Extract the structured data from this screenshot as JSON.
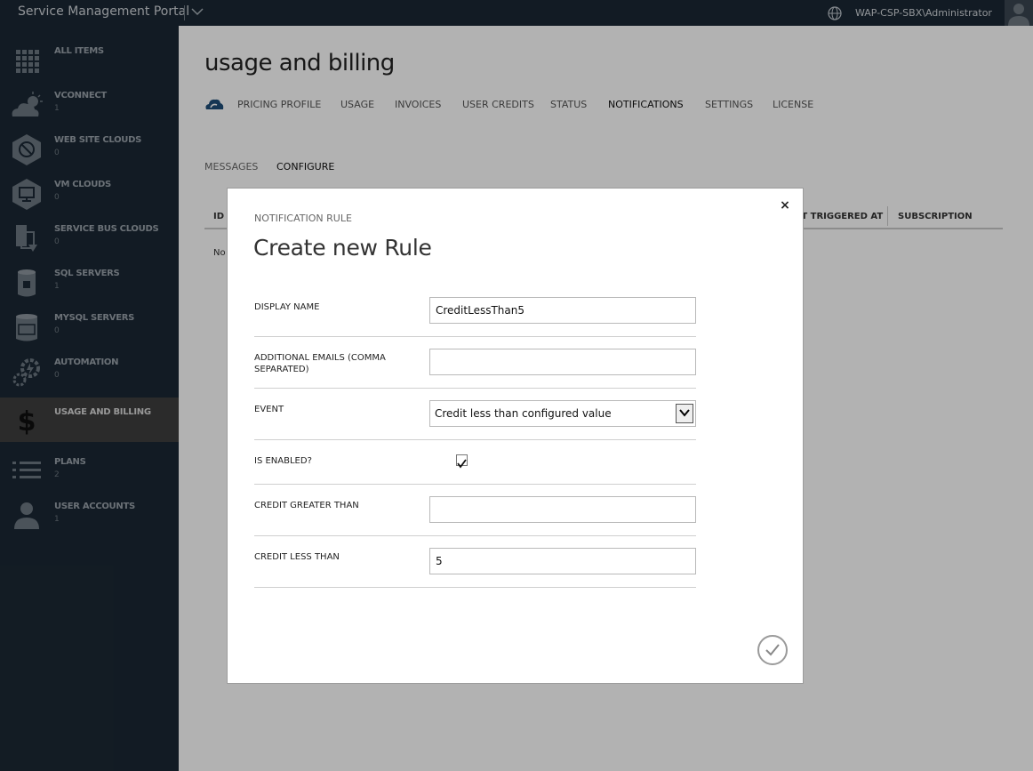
{
  "topbar": {
    "title": "Service Management Portal",
    "user": "WAP-CSP-SBX\\Administrator"
  },
  "sidebar": {
    "items": [
      {
        "label": "ALL ITEMS",
        "count": "",
        "icon": "grid-icon"
      },
      {
        "label": "VCONNECT",
        "count": "1",
        "icon": "cloud-sun-icon"
      },
      {
        "label": "WEB SITE CLOUDS",
        "count": "0",
        "icon": "website-cloud-icon"
      },
      {
        "label": "VM CLOUDS",
        "count": "0",
        "icon": "vm-monitor-icon"
      },
      {
        "label": "SERVICE BUS CLOUDS",
        "count": "0",
        "icon": "service-bus-icon"
      },
      {
        "label": "SQL SERVERS",
        "count": "1",
        "icon": "sql-database-icon"
      },
      {
        "label": "MYSQL SERVERS",
        "count": "0",
        "icon": "mysql-database-icon"
      },
      {
        "label": "AUTOMATION",
        "count": "0",
        "icon": "automation-gears-icon"
      },
      {
        "label": "USAGE AND BILLING",
        "count": "",
        "icon": "dollar-icon"
      },
      {
        "label": "PLANS",
        "count": "2",
        "icon": "plans-list-icon"
      },
      {
        "label": "USER ACCOUNTS",
        "count": "1",
        "icon": "user-icon"
      }
    ],
    "active_index": 8
  },
  "main": {
    "title": "usage and billing",
    "tabs": [
      "PRICING PROFILE",
      "USAGE",
      "INVOICES",
      "USER CREDITS",
      "STATUS",
      "NOTIFICATIONS",
      "SETTINGS",
      "LICENSE"
    ],
    "active_tab": "NOTIFICATIONS",
    "subtabs": [
      "MESSAGES",
      "CONFIGURE"
    ],
    "active_subtab": "CONFIGURE",
    "grid_headers": {
      "id": "ID",
      "last_triggered": "LAST TRIGGERED AT",
      "subscription": "SUBSCRIPTION"
    },
    "grid_empty_partial": "No"
  },
  "modal": {
    "eyebrow": "NOTIFICATION RULE",
    "heading": "Create new Rule",
    "close_glyph": "×",
    "fields": {
      "display_name": {
        "label": "DISPLAY NAME",
        "value": "CreditLessThan5"
      },
      "additional_emails": {
        "label": "ADDITIONAL EMAILS (COMMA SEPARATED)",
        "value": ""
      },
      "event": {
        "label": "EVENT",
        "value": "Credit less than configured value"
      },
      "is_enabled": {
        "label": "IS ENABLED?",
        "checked": true
      },
      "credit_greater_than": {
        "label": "CREDIT GREATER THAN",
        "value": ""
      },
      "credit_less_than": {
        "label": "CREDIT LESS THAN",
        "value": "5"
      }
    }
  }
}
